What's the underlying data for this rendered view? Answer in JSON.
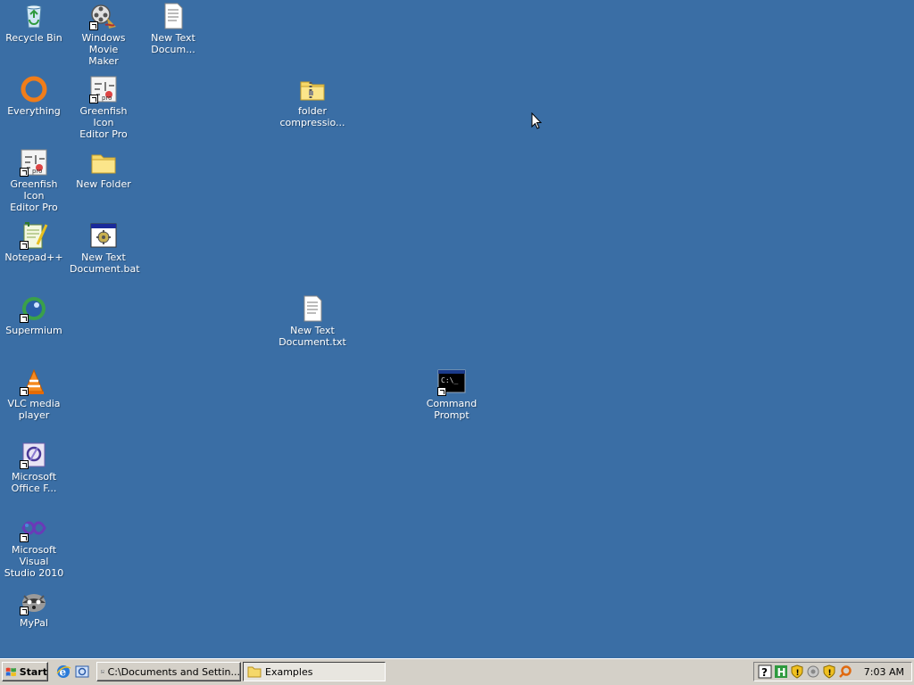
{
  "desktop": {
    "background": "#3a6ea5",
    "icons": [
      {
        "label": "Recycle Bin",
        "icon": "recycle-bin-icon"
      },
      {
        "label": "Windows Movie\nMaker",
        "icon": "movie-maker-icon"
      },
      {
        "label": "New Text\nDocum...",
        "icon": "text-document-icon"
      },
      {
        "label": "Everything",
        "icon": "everything-icon"
      },
      {
        "label": "Greenfish Icon\nEditor Pro",
        "icon": "greenfish-icon"
      },
      {
        "label": "folder\ncompressio...",
        "icon": "zip-folder-icon"
      },
      {
        "label": "Greenfish Icon\nEditor Pro",
        "icon": "greenfish-icon"
      },
      {
        "label": "New Folder",
        "icon": "folder-icon"
      },
      {
        "label": "Notepad++",
        "icon": "notepad-plus-plus-icon"
      },
      {
        "label": "New Text\nDocument.bat",
        "icon": "batch-file-icon"
      },
      {
        "label": "Supermium",
        "icon": "supermium-icon"
      },
      {
        "label": "New Text\nDocument.txt",
        "icon": "text-document-icon"
      },
      {
        "label": "VLC media\nplayer",
        "icon": "vlc-icon"
      },
      {
        "label": "Command\nPrompt",
        "icon": "command-prompt-icon"
      },
      {
        "label": "Microsoft\nOffice F...",
        "icon": "office-icon"
      },
      {
        "label": "Microsoft Visual\nStudio 2010",
        "icon": "visual-studio-icon"
      },
      {
        "label": "MyPal",
        "icon": "mypal-icon"
      }
    ]
  },
  "taskbar": {
    "start_label": "Start",
    "quick_launch": [
      "internet-explorer-icon",
      "show-desktop-icon"
    ],
    "tasks": [
      {
        "label": "C:\\Documents and Settin...",
        "icon": "7zip-icon",
        "active": false
      },
      {
        "label": "Examples",
        "icon": "folder-icon",
        "active": true
      }
    ],
    "tray_icons": [
      "help-icon",
      "hardware-icon",
      "security-shield-icon",
      "network-icon",
      "shield-alert-icon",
      "search-icon"
    ],
    "clock": "7:03 AM"
  }
}
